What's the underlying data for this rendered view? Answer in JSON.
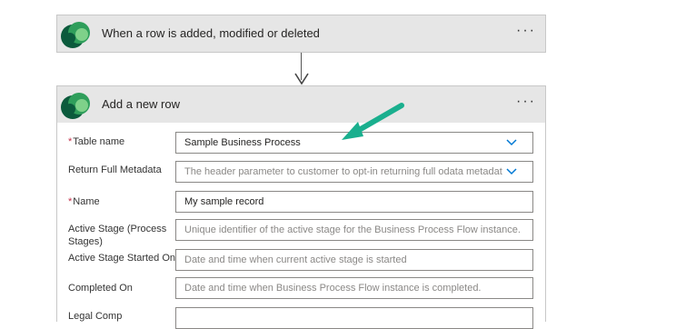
{
  "trigger": {
    "title": "When a row is added, modified or deleted",
    "more_label": "···",
    "icon": "dataverse-logo-icon"
  },
  "action": {
    "title": "Add a new row",
    "more_label": "···",
    "icon": "dataverse-logo-icon",
    "fields": [
      {
        "label": "Table name",
        "required": "*",
        "value": "Sample Business Process",
        "placeholder": "",
        "has_dropdown": true
      },
      {
        "label": "Return Full Metadata",
        "required": "",
        "value": "",
        "placeholder": "The header parameter to customer to opt-in returning full odata metadat",
        "has_dropdown": true
      },
      {
        "label": "Name",
        "required": "*",
        "value": "My sample record",
        "placeholder": "",
        "has_dropdown": false
      },
      {
        "label": "Active Stage (Process Stages)",
        "required": "",
        "value": "",
        "placeholder": "Unique identifier of the active stage for the Business Process Flow instance.",
        "has_dropdown": false
      },
      {
        "label": "Active Stage Started On",
        "required": "",
        "value": "",
        "placeholder": "Date and time when current active stage is started",
        "has_dropdown": false
      },
      {
        "label": "Completed On",
        "required": "",
        "value": "",
        "placeholder": "Date and time when Business Process Flow instance is completed.",
        "has_dropdown": false
      },
      {
        "label": "Legal Comp",
        "required": "",
        "value": "",
        "placeholder": "",
        "has_dropdown": false
      }
    ]
  },
  "colors": {
    "header_bg": "#e6e6e6",
    "annotation_arrow": "#1aaf8e",
    "required_star": "#c4314b",
    "chevron": "#0078d4"
  }
}
